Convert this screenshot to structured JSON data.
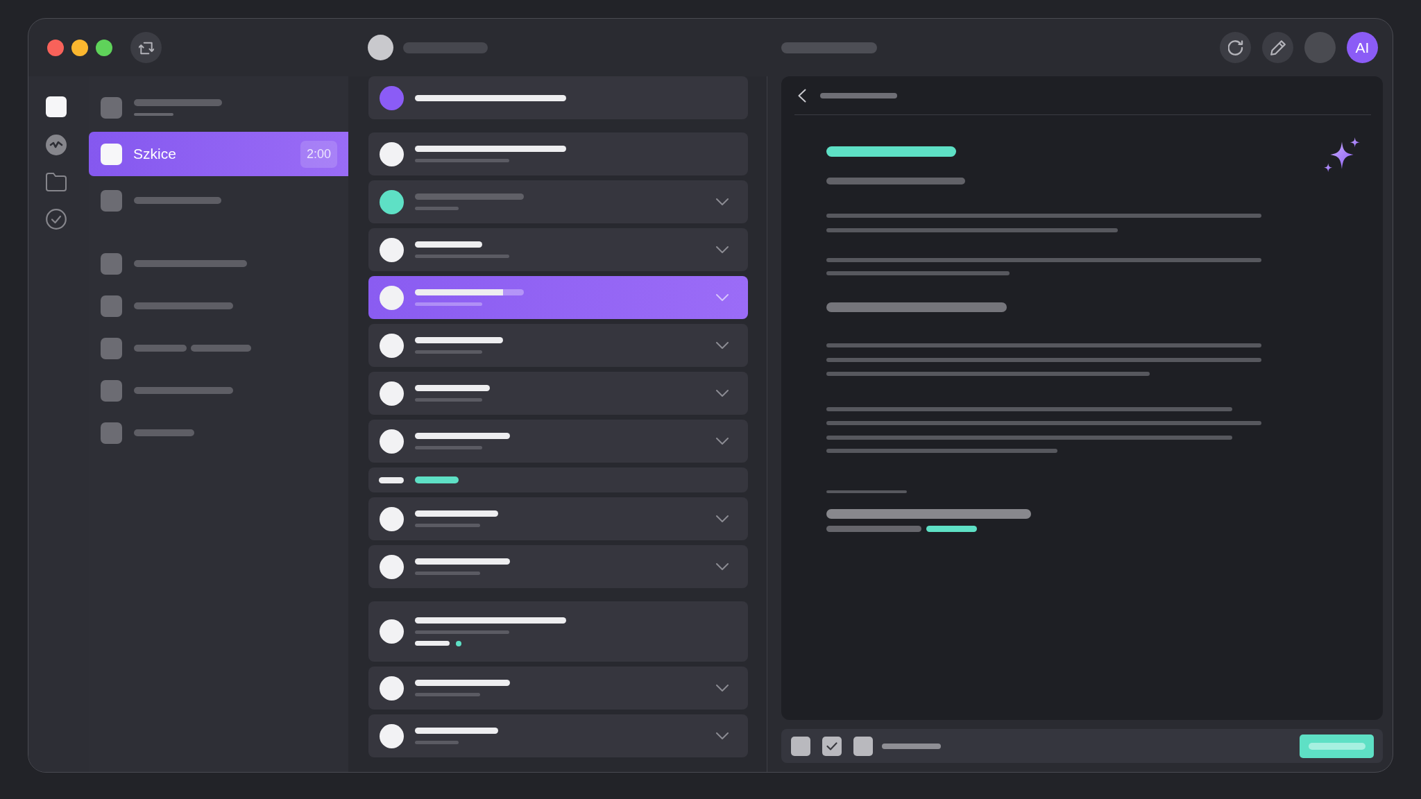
{
  "toolbar": {
    "avatar": "AI"
  },
  "rail": [
    {
      "selected": true
    },
    {
      "selected": false
    },
    {
      "selected": false
    },
    {
      "selected": false
    }
  ],
  "sidebar": {
    "groups": [
      {
        "items": [
          {
            "selected": false
          },
          {
            "label": "Szkice",
            "badge": "2:00",
            "selected": true
          },
          {
            "selected": false
          }
        ]
      },
      {
        "items": [
          {
            "selected": false
          },
          {
            "selected": false
          },
          {
            "selected": false
          },
          {
            "selected": false
          },
          {
            "selected": false
          }
        ]
      }
    ]
  },
  "list": {
    "groups": [
      {
        "rows": [
          {
            "kind": "single",
            "color": "#8b5cf6",
            "selected": false,
            "dimmed": false
          }
        ]
      },
      {
        "rows": [
          {
            "kind": "plain",
            "color": "#f2f2f4",
            "selected": false,
            "dimmed": false
          },
          {
            "kind": "expandable",
            "color": "#5ee0c5",
            "selected": false,
            "dimmed": true
          },
          {
            "kind": "expandable",
            "color": "#f2f2f4",
            "selected": false,
            "dimmed": false
          },
          {
            "kind": "expandable",
            "color": "#f2f2f4",
            "selected": true,
            "dimmed": false
          },
          {
            "kind": "expandable",
            "color": "#f2f2f4",
            "selected": false,
            "dimmed": false
          },
          {
            "kind": "expandable",
            "color": "#f2f2f4",
            "selected": false,
            "dimmed": false
          },
          {
            "kind": "expandable",
            "color": "#f2f2f4",
            "selected": false,
            "dimmed": false
          },
          {
            "kind": "tags",
            "selected": false
          },
          {
            "kind": "expandable",
            "color": "#f2f2f4",
            "selected": false,
            "dimmed": false
          },
          {
            "kind": "expandable",
            "color": "#f2f2f4",
            "selected": false,
            "dimmed": false
          }
        ]
      },
      {
        "rows": [
          {
            "kind": "detail",
            "color": "#f2f2f4",
            "selected": false,
            "dimmed": false
          },
          {
            "kind": "expandable",
            "color": "#f2f2f4",
            "selected": false,
            "dimmed": false
          },
          {
            "kind": "expandable",
            "color": "#f2f2f4",
            "selected": false,
            "dimmed": false
          }
        ]
      }
    ]
  },
  "detail": {
    "checkboxes": [
      {
        "checked": false
      },
      {
        "checked": true
      },
      {
        "checked": false
      }
    ]
  }
}
